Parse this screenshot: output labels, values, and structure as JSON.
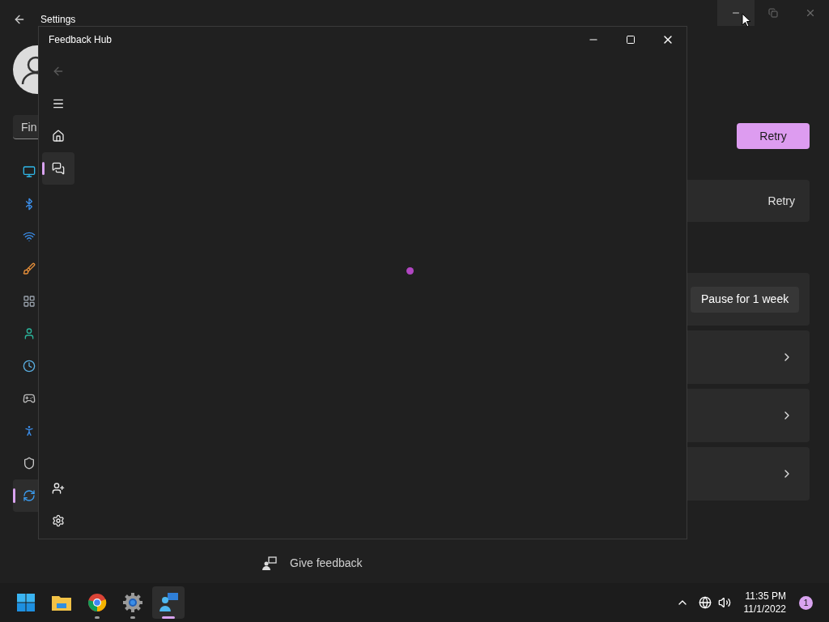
{
  "settings": {
    "title": "Settings",
    "search": {
      "placeholder": "Fin"
    },
    "nav_items": [
      {
        "kind": "display",
        "selected": false
      },
      {
        "kind": "bluetooth",
        "selected": false
      },
      {
        "kind": "wifi",
        "selected": false
      },
      {
        "kind": "brush",
        "selected": false
      },
      {
        "kind": "apps",
        "selected": false
      },
      {
        "kind": "account",
        "selected": false
      },
      {
        "kind": "time",
        "selected": false
      },
      {
        "kind": "gaming",
        "selected": false
      },
      {
        "kind": "accessibility",
        "selected": false
      },
      {
        "kind": "shield",
        "selected": false
      },
      {
        "kind": "update",
        "selected": true
      }
    ],
    "retry_button": "Retry",
    "retry_card": {
      "action": "Retry"
    },
    "pause_card": {
      "button": "Pause for 1 week"
    },
    "link_cards": [
      {
        "kind": "link"
      },
      {
        "kind": "link"
      },
      {
        "kind": "link"
      }
    ],
    "links": [
      {
        "label": "Give feedback"
      }
    ]
  },
  "feedback_hub": {
    "title": "Feedback Hub",
    "loading": true,
    "rail_items": [
      {
        "kind": "back",
        "disabled": true,
        "selected": false
      },
      {
        "kind": "menu",
        "disabled": false,
        "selected": false
      },
      {
        "kind": "home",
        "disabled": false,
        "selected": false
      },
      {
        "kind": "feedback",
        "disabled": false,
        "selected": true
      }
    ],
    "rail_bottom": [
      {
        "kind": "add-account"
      },
      {
        "kind": "settings"
      }
    ]
  },
  "taskbar": {
    "apps": [
      {
        "kind": "start",
        "running": false,
        "selected": false
      },
      {
        "kind": "folder",
        "running": false,
        "selected": false
      },
      {
        "kind": "chrome",
        "running": true,
        "selected": false
      },
      {
        "kind": "settings",
        "running": true,
        "selected": false
      },
      {
        "kind": "feedback",
        "running": true,
        "selected": true
      }
    ],
    "tray": {
      "time": "11:35 PM",
      "date": "11/1/2022",
      "notifications": "1"
    }
  }
}
